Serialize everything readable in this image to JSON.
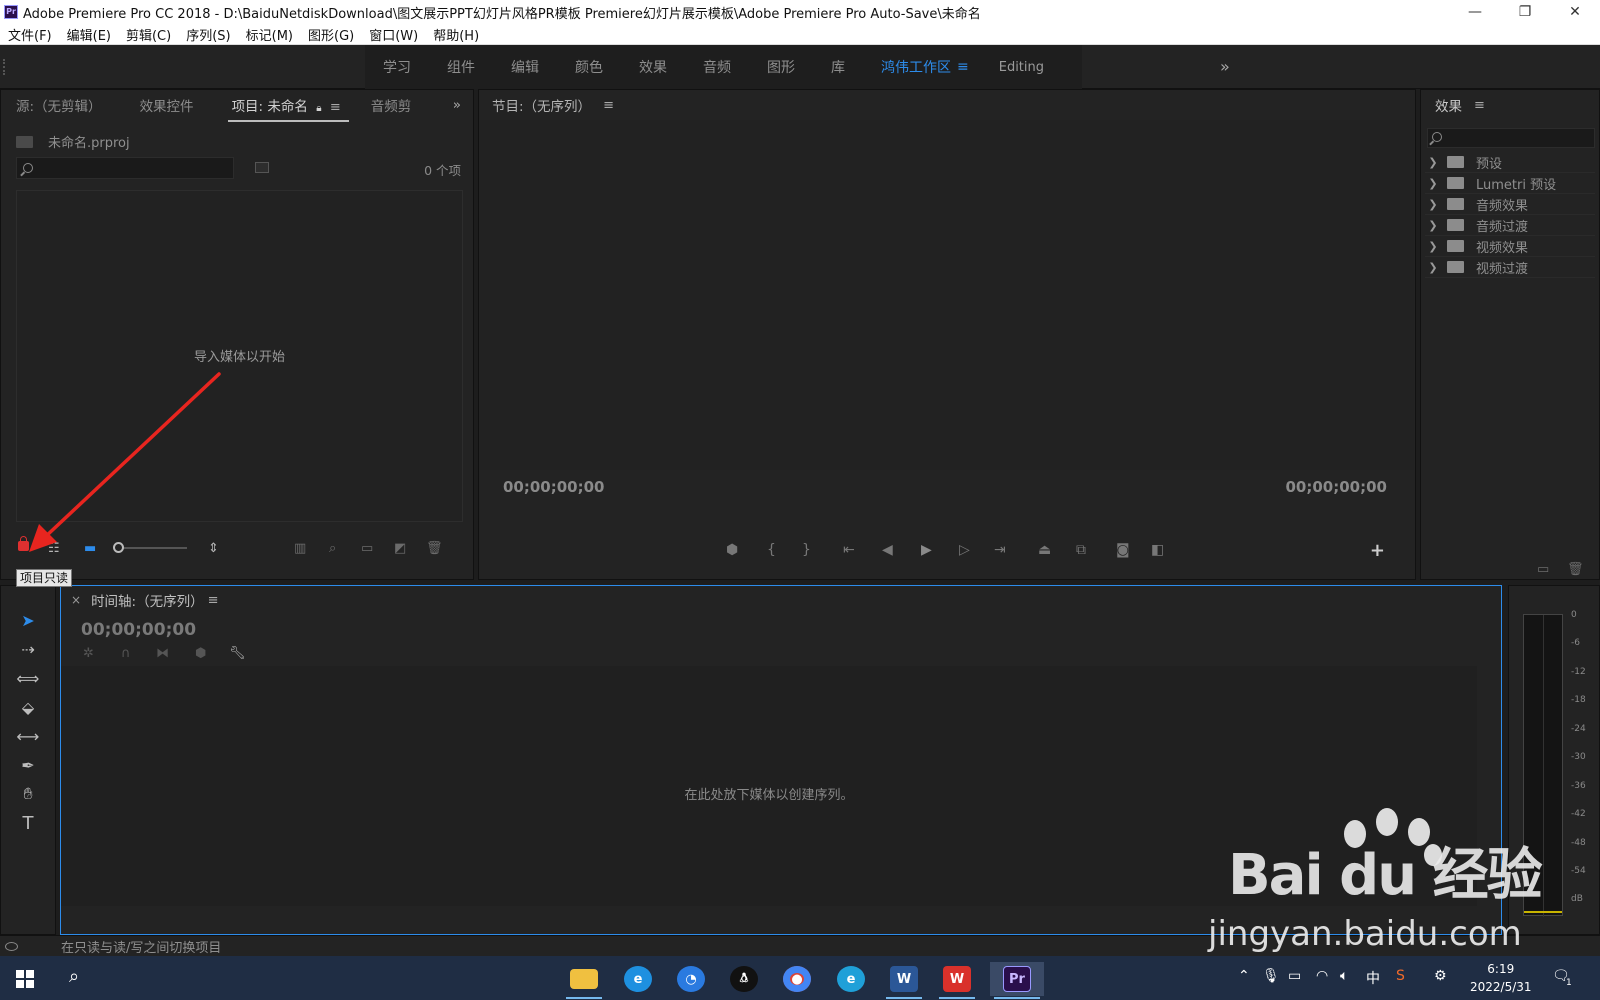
{
  "titlebar": {
    "app_icon": "Pr",
    "title": "Adobe Premiere Pro CC 2018 - D:\\BaiduNetdiskDownload\\图文展示PPT幻灯片风格PR模板 Premiere幻灯片展示模板\\Adobe Premiere Pro Auto-Save\\未命名",
    "minimize": "—",
    "restore": "❐",
    "close": "✕"
  },
  "menubar": {
    "items": [
      "文件(F)",
      "编辑(E)",
      "剪辑(C)",
      "序列(S)",
      "标记(M)",
      "图形(G)",
      "窗口(W)",
      "帮助(H)"
    ]
  },
  "workspaces": {
    "tabs": [
      "学习",
      "组件",
      "编辑",
      "颜色",
      "效果",
      "音频",
      "图形",
      "库"
    ],
    "active": "鸿伟工作区",
    "active_menu": "≡",
    "editing": "Editing",
    "more": "»"
  },
  "project_panel": {
    "tabs": [
      "源:（无剪辑）",
      "效果控件",
      "项目: 未命名",
      "音频剪"
    ],
    "more": "»",
    "file_name": "未命名.prproj",
    "item_count": "0 个项",
    "empty_hint": "导入媒体以开始",
    "tooltip": "项目只读"
  },
  "program_monitor": {
    "title": "节目:（无序列）",
    "timecode_left": "00;00;00;00",
    "timecode_right": "00;00;00;00",
    "add_button": "+"
  },
  "effects_panel": {
    "title": "效果",
    "items": [
      "预设",
      "Lumetri 预设",
      "音频效果",
      "音频过渡",
      "视频效果",
      "视频过渡"
    ]
  },
  "timeline": {
    "close": "×",
    "title": "时间轴:（无序列）",
    "timecode": "00;00;00;00",
    "drop_hint": "在此处放下媒体以创建序列。"
  },
  "audio_meter": {
    "scale": [
      "0",
      "-6",
      "-12",
      "-18",
      "-24",
      "-30",
      "-36",
      "-42",
      "-48",
      "-54",
      "dB"
    ]
  },
  "statusbar": {
    "text": "在只读与读/写之间切换项目"
  },
  "taskbar": {
    "clock_time": "6:19",
    "clock_date": "2022/5/31",
    "ime": "中",
    "notification_count": "1"
  },
  "watermark": {
    "logo": "Bai du 经验",
    "url": "jingyan.baidu.com"
  },
  "colors": {
    "accent_blue": "#2d8ceb",
    "annotation_red": "#e8251f"
  }
}
